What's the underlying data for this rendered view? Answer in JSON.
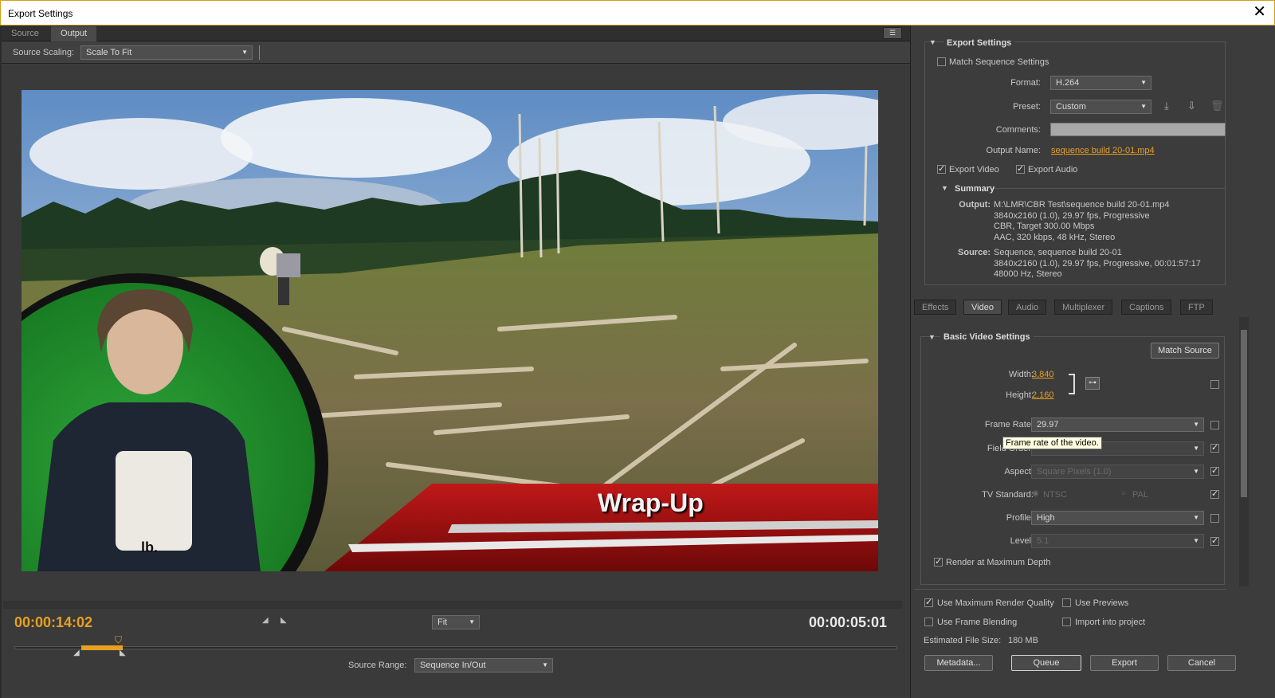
{
  "window": {
    "title": "Export Settings",
    "close_glyph": "✕"
  },
  "left_tabs": [
    "Source",
    "Output"
  ],
  "source_scaling": {
    "label": "Source Scaling:",
    "value": "Scale To Fit"
  },
  "overlay": {
    "title": "Wrap-Up"
  },
  "timeline": {
    "current_tc": "00:00:14:02",
    "duration_tc": "00:00:05:01",
    "zoom": "Fit",
    "source_range_label": "Source Range:",
    "source_range_value": "Sequence In/Out"
  },
  "export_settings": {
    "header": "Export Settings",
    "match_sequence": "Match Sequence Settings",
    "format_label": "Format:",
    "format_value": "H.264",
    "preset_label": "Preset:",
    "preset_value": "Custom",
    "comments_label": "Comments:",
    "comments_value": "",
    "output_name_label": "Output Name:",
    "output_name_value": "sequence build 20-01.mp4",
    "export_video": "Export Video",
    "export_audio": "Export Audio"
  },
  "summary": {
    "header": "Summary",
    "output_label": "Output:",
    "output_lines": [
      "M:\\LMR\\CBR Test\\sequence build 20-01.mp4",
      "3840x2160 (1.0), 29.97 fps, Progressive",
      "CBR, Target 300.00 Mbps",
      "AAC, 320 kbps, 48 kHz, Stereo"
    ],
    "source_label": "Source:",
    "source_lines": [
      "Sequence, sequence build 20-01",
      "3840x2160 (1.0), 29.97 fps, Progressive, 00:01:57:17",
      "48000 Hz, Stereo"
    ]
  },
  "right_tabs": [
    "Effects",
    "Video",
    "Audio",
    "Multiplexer",
    "Captions",
    "FTP"
  ],
  "video": {
    "header": "Basic Video Settings",
    "match_source": "Match Source",
    "width_label": "Width:",
    "width_value": "3,840",
    "height_label": "Height:",
    "height_value": "2,160",
    "frame_rate_label": "Frame Rate:",
    "frame_rate_value": "29.97",
    "tooltip": "Frame rate of the video.",
    "field_order_label": "Field Order:",
    "aspect_label": "Aspect:",
    "aspect_value": "Square Pixels (1.0)",
    "tv_label": "TV Standard:",
    "tv_ntsc": "NTSC",
    "tv_pal": "PAL",
    "profile_label": "Profile:",
    "profile_value": "High",
    "level_label": "Level:",
    "level_value": "5.1",
    "render_max_depth": "Render at Maximum Depth"
  },
  "bottom": {
    "max_quality": "Use Maximum Render Quality",
    "use_previews": "Use Previews",
    "frame_blending": "Use Frame Blending",
    "import_project": "Import into project",
    "est_size_label": "Estimated File Size:",
    "est_size_value": "180 MB",
    "metadata": "Metadata...",
    "queue": "Queue",
    "export": "Export",
    "cancel": "Cancel"
  },
  "colors": {
    "accent": "#e8a020",
    "panel": "#3c3c3c",
    "banner_red": "#a01010"
  }
}
